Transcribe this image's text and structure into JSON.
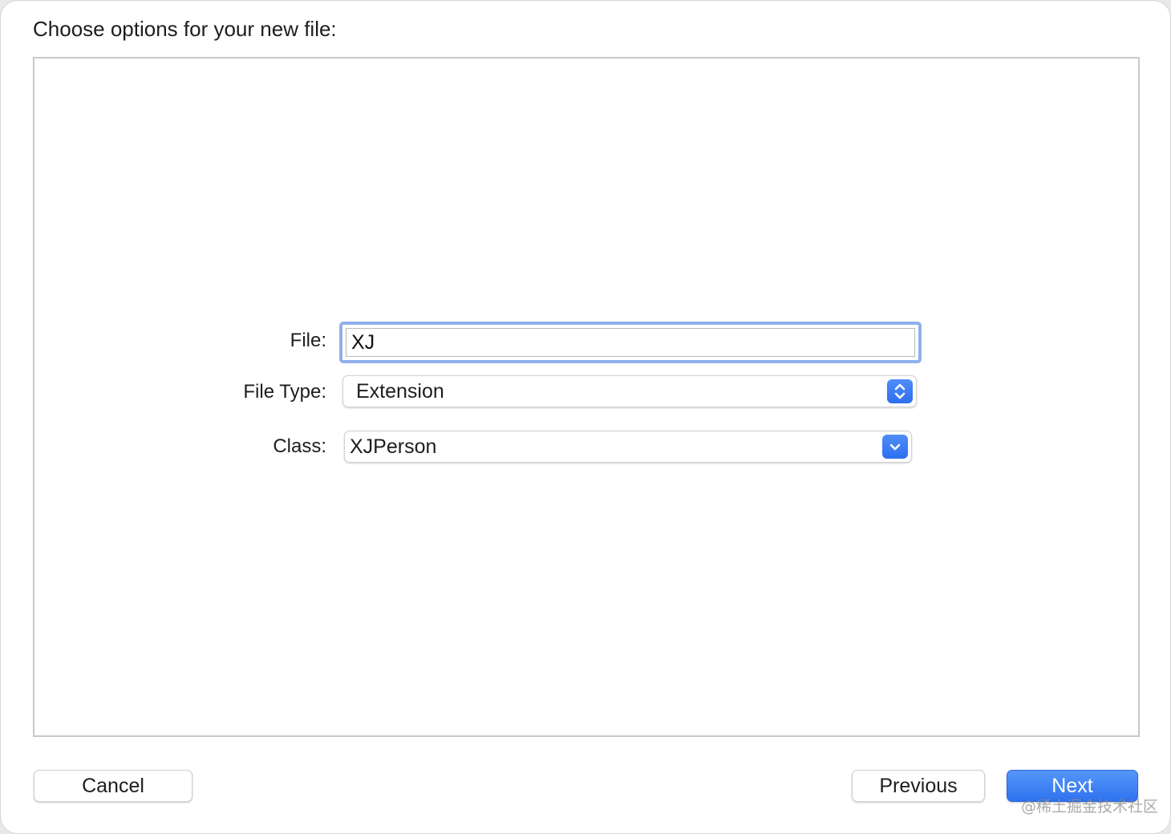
{
  "dialog": {
    "heading": "Choose options for your new file:"
  },
  "form": {
    "file_label": "File:",
    "file_value": "XJ",
    "file_type_label": "File Type:",
    "file_type_value": "Extension",
    "class_label": "Class:",
    "class_value": "XJPerson"
  },
  "buttons": {
    "cancel": "Cancel",
    "previous": "Previous",
    "next": "Next"
  },
  "watermark": "@稀土掘金技术社区",
  "colors": {
    "accent": "#2f72ee",
    "focus_ring": "#8fb0ec"
  },
  "icons": {
    "file_type_popup": "up-down-chevron-icon",
    "class_popup": "chevron-down-icon"
  }
}
